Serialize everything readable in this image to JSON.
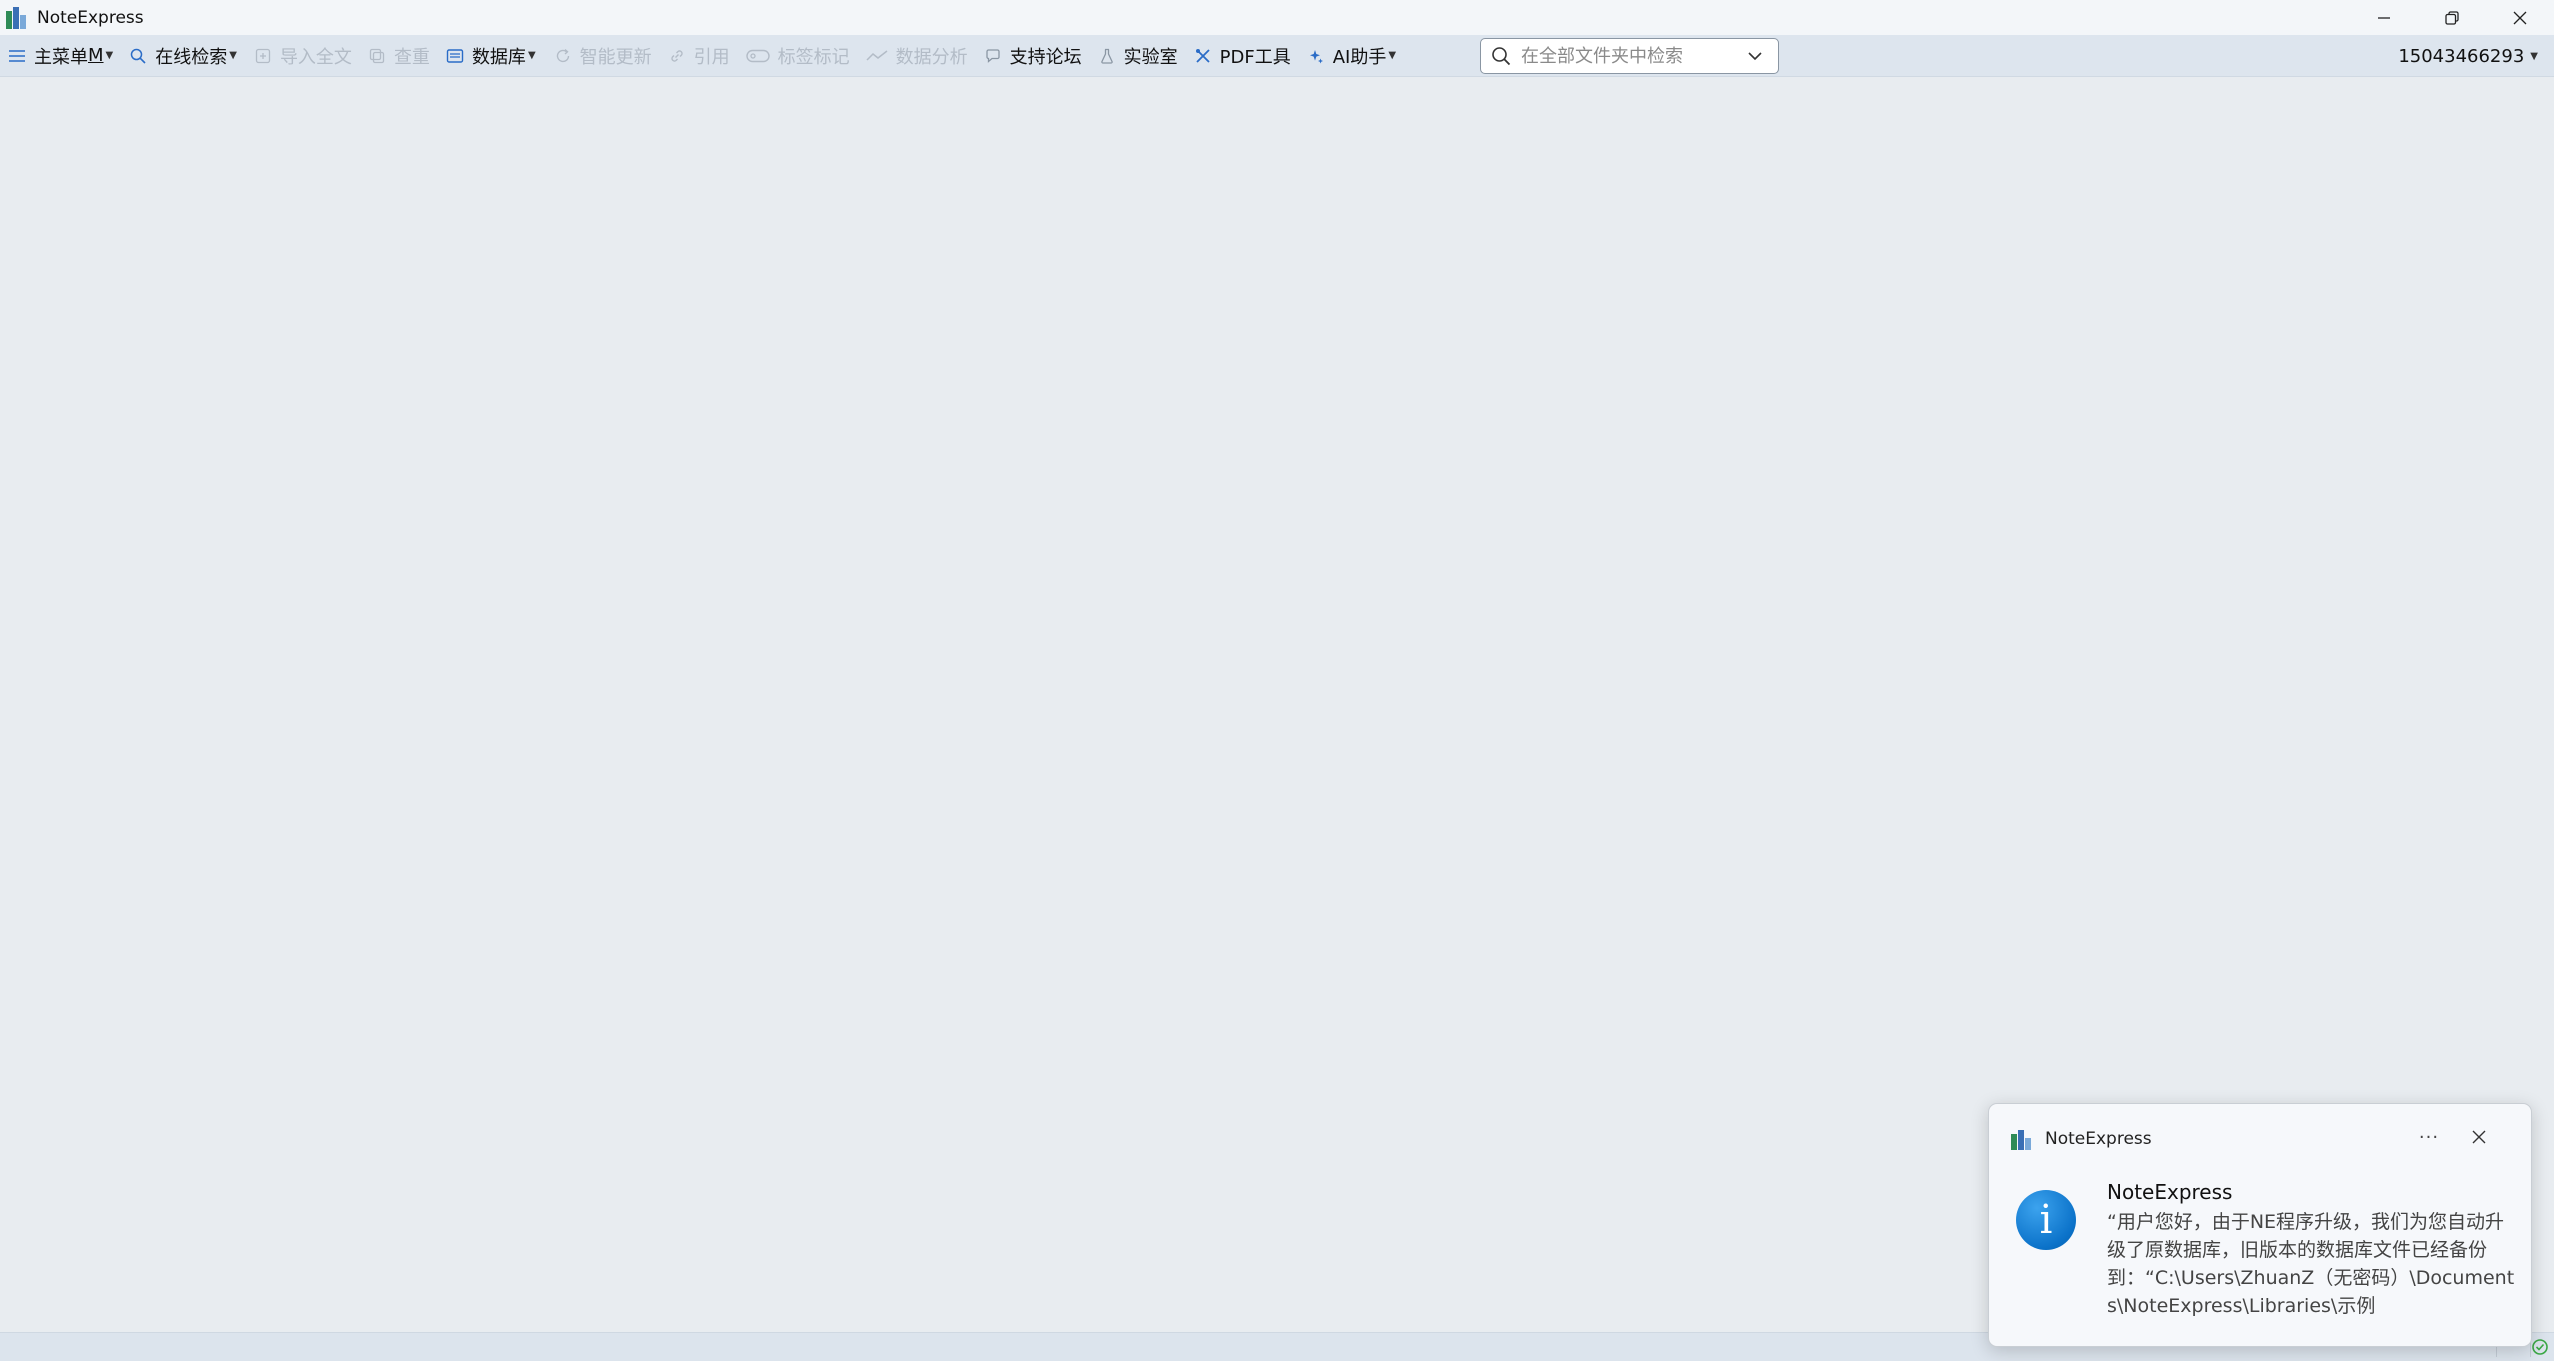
{
  "window": {
    "title": "NoteExpress",
    "minimize_label": "Minimize",
    "restore_label": "Restore",
    "close_label": "Close"
  },
  "toolbar": {
    "items": [
      {
        "label": "主菜单",
        "accel": "M",
        "icon": "hamburger-menu-icon",
        "enabled": true,
        "dropdown": true
      },
      {
        "label": "在线检索",
        "icon": "search-icon",
        "enabled": true,
        "dropdown": true
      },
      {
        "label": "导入全文",
        "icon": "import-icon",
        "enabled": false
      },
      {
        "label": "查重",
        "icon": "duplicate-icon",
        "enabled": false
      },
      {
        "label": "数据库",
        "icon": "database-icon",
        "enabled": true,
        "dropdown": true
      },
      {
        "label": "智能更新",
        "icon": "refresh-icon",
        "enabled": false
      },
      {
        "label": "引用",
        "icon": "link-icon",
        "enabled": false
      },
      {
        "label": "标签标记",
        "icon": "tag-icon",
        "enabled": false
      },
      {
        "label": "数据分析",
        "icon": "trend-icon",
        "enabled": false
      },
      {
        "label": "支持论坛",
        "icon": "chat-icon",
        "enabled": true
      },
      {
        "label": "实验室",
        "icon": "flask-icon",
        "enabled": true
      },
      {
        "label": "PDF工具",
        "icon": "tools-icon",
        "enabled": true
      },
      {
        "label": "AI助手",
        "icon": "sparkle-icon",
        "enabled": true,
        "dropdown": true
      }
    ],
    "search": {
      "placeholder": "在全部文件夹中检索",
      "value": ""
    },
    "user": "15043466293"
  },
  "notification": {
    "app_name": "NoteExpress",
    "title": "NoteExpress",
    "body": "“用户您好，由于NE程序升级，我们为您自动升级了原数据库，旧版本的数据库文件已经备份到：“C:\\Users\\ZhuanZ（无密码）\\Documents\\NoteExpress\\Libraries\\示例",
    "more_label": "···"
  },
  "colors": {
    "accent": "#1a6fc4",
    "disabled_text": "#b3bcc7",
    "toolbar_bg": "#dde5ee",
    "workspace_bg": "#e8ecf0",
    "info_icon": "#0b72c9"
  }
}
